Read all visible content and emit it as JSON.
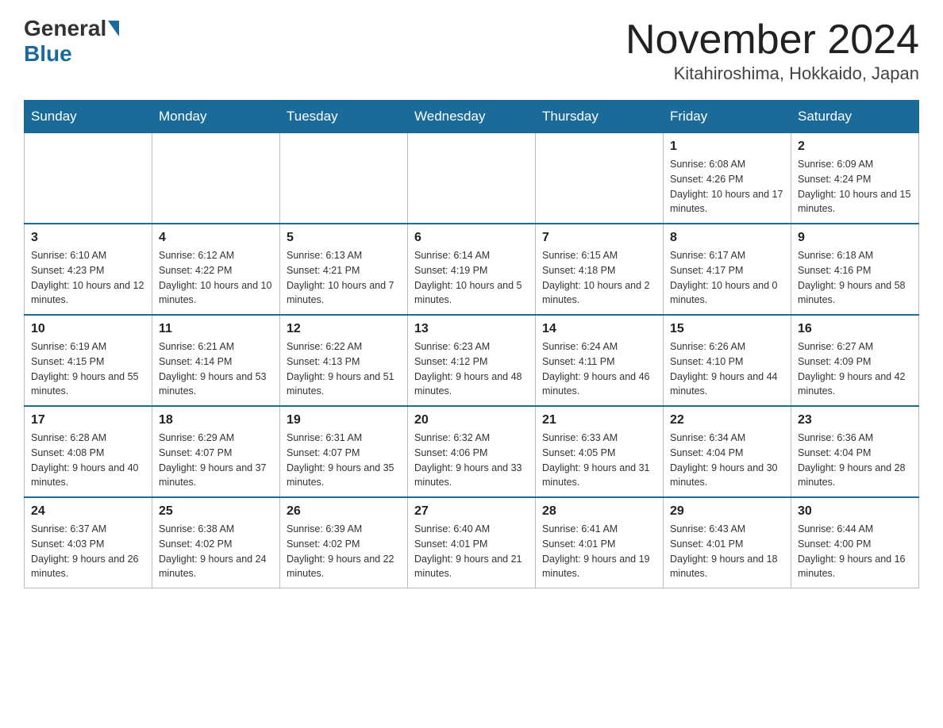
{
  "header": {
    "logo_general": "General",
    "logo_blue": "Blue",
    "title": "November 2024",
    "location": "Kitahiroshima, Hokkaido, Japan"
  },
  "weekdays": [
    "Sunday",
    "Monday",
    "Tuesday",
    "Wednesday",
    "Thursday",
    "Friday",
    "Saturday"
  ],
  "rows": [
    [
      {
        "day": "",
        "sunrise": "",
        "sunset": "",
        "daylight": ""
      },
      {
        "day": "",
        "sunrise": "",
        "sunset": "",
        "daylight": ""
      },
      {
        "day": "",
        "sunrise": "",
        "sunset": "",
        "daylight": ""
      },
      {
        "day": "",
        "sunrise": "",
        "sunset": "",
        "daylight": ""
      },
      {
        "day": "",
        "sunrise": "",
        "sunset": "",
        "daylight": ""
      },
      {
        "day": "1",
        "sunrise": "Sunrise: 6:08 AM",
        "sunset": "Sunset: 4:26 PM",
        "daylight": "Daylight: 10 hours and 17 minutes."
      },
      {
        "day": "2",
        "sunrise": "Sunrise: 6:09 AM",
        "sunset": "Sunset: 4:24 PM",
        "daylight": "Daylight: 10 hours and 15 minutes."
      }
    ],
    [
      {
        "day": "3",
        "sunrise": "Sunrise: 6:10 AM",
        "sunset": "Sunset: 4:23 PM",
        "daylight": "Daylight: 10 hours and 12 minutes."
      },
      {
        "day": "4",
        "sunrise": "Sunrise: 6:12 AM",
        "sunset": "Sunset: 4:22 PM",
        "daylight": "Daylight: 10 hours and 10 minutes."
      },
      {
        "day": "5",
        "sunrise": "Sunrise: 6:13 AM",
        "sunset": "Sunset: 4:21 PM",
        "daylight": "Daylight: 10 hours and 7 minutes."
      },
      {
        "day": "6",
        "sunrise": "Sunrise: 6:14 AM",
        "sunset": "Sunset: 4:19 PM",
        "daylight": "Daylight: 10 hours and 5 minutes."
      },
      {
        "day": "7",
        "sunrise": "Sunrise: 6:15 AM",
        "sunset": "Sunset: 4:18 PM",
        "daylight": "Daylight: 10 hours and 2 minutes."
      },
      {
        "day": "8",
        "sunrise": "Sunrise: 6:17 AM",
        "sunset": "Sunset: 4:17 PM",
        "daylight": "Daylight: 10 hours and 0 minutes."
      },
      {
        "day": "9",
        "sunrise": "Sunrise: 6:18 AM",
        "sunset": "Sunset: 4:16 PM",
        "daylight": "Daylight: 9 hours and 58 minutes."
      }
    ],
    [
      {
        "day": "10",
        "sunrise": "Sunrise: 6:19 AM",
        "sunset": "Sunset: 4:15 PM",
        "daylight": "Daylight: 9 hours and 55 minutes."
      },
      {
        "day": "11",
        "sunrise": "Sunrise: 6:21 AM",
        "sunset": "Sunset: 4:14 PM",
        "daylight": "Daylight: 9 hours and 53 minutes."
      },
      {
        "day": "12",
        "sunrise": "Sunrise: 6:22 AM",
        "sunset": "Sunset: 4:13 PM",
        "daylight": "Daylight: 9 hours and 51 minutes."
      },
      {
        "day": "13",
        "sunrise": "Sunrise: 6:23 AM",
        "sunset": "Sunset: 4:12 PM",
        "daylight": "Daylight: 9 hours and 48 minutes."
      },
      {
        "day": "14",
        "sunrise": "Sunrise: 6:24 AM",
        "sunset": "Sunset: 4:11 PM",
        "daylight": "Daylight: 9 hours and 46 minutes."
      },
      {
        "day": "15",
        "sunrise": "Sunrise: 6:26 AM",
        "sunset": "Sunset: 4:10 PM",
        "daylight": "Daylight: 9 hours and 44 minutes."
      },
      {
        "day": "16",
        "sunrise": "Sunrise: 6:27 AM",
        "sunset": "Sunset: 4:09 PM",
        "daylight": "Daylight: 9 hours and 42 minutes."
      }
    ],
    [
      {
        "day": "17",
        "sunrise": "Sunrise: 6:28 AM",
        "sunset": "Sunset: 4:08 PM",
        "daylight": "Daylight: 9 hours and 40 minutes."
      },
      {
        "day": "18",
        "sunrise": "Sunrise: 6:29 AM",
        "sunset": "Sunset: 4:07 PM",
        "daylight": "Daylight: 9 hours and 37 minutes."
      },
      {
        "day": "19",
        "sunrise": "Sunrise: 6:31 AM",
        "sunset": "Sunset: 4:07 PM",
        "daylight": "Daylight: 9 hours and 35 minutes."
      },
      {
        "day": "20",
        "sunrise": "Sunrise: 6:32 AM",
        "sunset": "Sunset: 4:06 PM",
        "daylight": "Daylight: 9 hours and 33 minutes."
      },
      {
        "day": "21",
        "sunrise": "Sunrise: 6:33 AM",
        "sunset": "Sunset: 4:05 PM",
        "daylight": "Daylight: 9 hours and 31 minutes."
      },
      {
        "day": "22",
        "sunrise": "Sunrise: 6:34 AM",
        "sunset": "Sunset: 4:04 PM",
        "daylight": "Daylight: 9 hours and 30 minutes."
      },
      {
        "day": "23",
        "sunrise": "Sunrise: 6:36 AM",
        "sunset": "Sunset: 4:04 PM",
        "daylight": "Daylight: 9 hours and 28 minutes."
      }
    ],
    [
      {
        "day": "24",
        "sunrise": "Sunrise: 6:37 AM",
        "sunset": "Sunset: 4:03 PM",
        "daylight": "Daylight: 9 hours and 26 minutes."
      },
      {
        "day": "25",
        "sunrise": "Sunrise: 6:38 AM",
        "sunset": "Sunset: 4:02 PM",
        "daylight": "Daylight: 9 hours and 24 minutes."
      },
      {
        "day": "26",
        "sunrise": "Sunrise: 6:39 AM",
        "sunset": "Sunset: 4:02 PM",
        "daylight": "Daylight: 9 hours and 22 minutes."
      },
      {
        "day": "27",
        "sunrise": "Sunrise: 6:40 AM",
        "sunset": "Sunset: 4:01 PM",
        "daylight": "Daylight: 9 hours and 21 minutes."
      },
      {
        "day": "28",
        "sunrise": "Sunrise: 6:41 AM",
        "sunset": "Sunset: 4:01 PM",
        "daylight": "Daylight: 9 hours and 19 minutes."
      },
      {
        "day": "29",
        "sunrise": "Sunrise: 6:43 AM",
        "sunset": "Sunset: 4:01 PM",
        "daylight": "Daylight: 9 hours and 18 minutes."
      },
      {
        "day": "30",
        "sunrise": "Sunrise: 6:44 AM",
        "sunset": "Sunset: 4:00 PM",
        "daylight": "Daylight: 9 hours and 16 minutes."
      }
    ]
  ]
}
